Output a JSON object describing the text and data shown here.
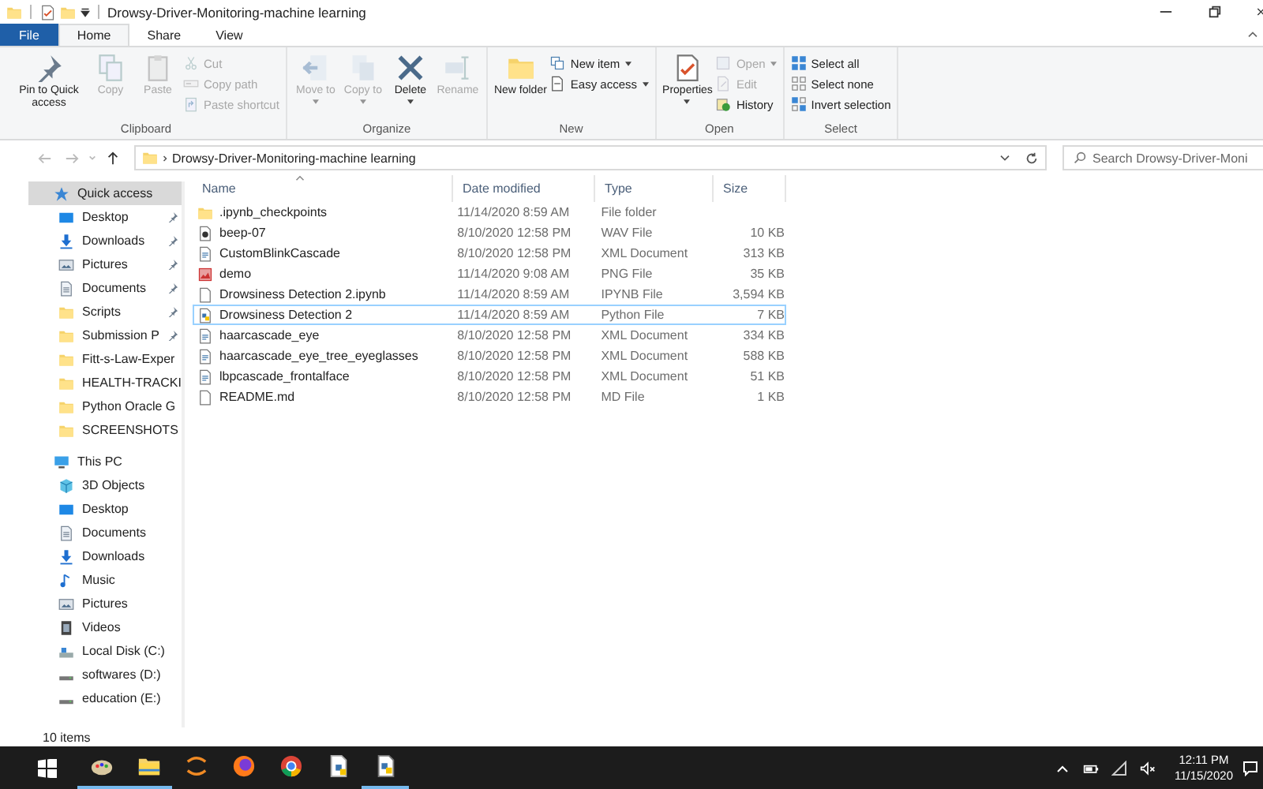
{
  "window": {
    "title": "Drowsy-Driver-Monitoring-machine learning"
  },
  "ribbon_tabs": [
    {
      "label": "File",
      "kind": "file",
      "selected": false
    },
    {
      "label": "Home",
      "kind": "tab",
      "selected": true
    },
    {
      "label": "Share",
      "kind": "tab",
      "selected": false
    },
    {
      "label": "View",
      "kind": "tab",
      "selected": false
    }
  ],
  "ribbon_groups": [
    {
      "label": "Clipboard",
      "large_commands": [
        {
          "label": "Pin to Quick access",
          "kind": "pin",
          "disabled": false,
          "dropdown": false
        },
        {
          "label": "Copy",
          "kind": "copy",
          "disabled": true,
          "dropdown": false
        },
        {
          "label": "Paste",
          "kind": "paste",
          "disabled": true,
          "dropdown": false
        }
      ],
      "small_commands": [
        {
          "label": "Cut",
          "kind": "cut",
          "disabled": true,
          "dropdown": false
        },
        {
          "label": "Copy path",
          "kind": "copypath",
          "disabled": true,
          "dropdown": false
        },
        {
          "label": "Paste shortcut",
          "kind": "pasteshortcut",
          "disabled": true,
          "dropdown": false
        }
      ]
    },
    {
      "label": "Organize",
      "large_commands": [
        {
          "label": "Move to",
          "kind": "moveto",
          "disabled": true,
          "dropdown": true
        },
        {
          "label": "Copy to",
          "kind": "copyto",
          "disabled": true,
          "dropdown": true
        },
        {
          "label": "Delete",
          "kind": "delete",
          "disabled": false,
          "dropdown": true
        },
        {
          "label": "Rename",
          "kind": "rename",
          "disabled": true,
          "dropdown": false
        }
      ]
    },
    {
      "label": "New",
      "large_commands": [
        {
          "label": "New folder",
          "kind": "folder",
          "disabled": false,
          "dropdown": false
        }
      ],
      "small_commands": [
        {
          "label": "New item",
          "kind": "newitem",
          "disabled": false,
          "dropdown": true
        },
        {
          "label": "Easy access",
          "kind": "easyaccess",
          "disabled": false,
          "dropdown": true
        }
      ]
    },
    {
      "label": "Open",
      "large_commands": [
        {
          "label": "Properties",
          "kind": "properties",
          "disabled": false,
          "dropdown": true
        }
      ],
      "small_commands": [
        {
          "label": "Open",
          "kind": "open",
          "disabled": true,
          "dropdown": true
        },
        {
          "label": "Edit",
          "kind": "edit",
          "disabled": true,
          "dropdown": false
        },
        {
          "label": "History",
          "kind": "history",
          "disabled": false,
          "dropdown": false
        }
      ]
    },
    {
      "label": "Select",
      "small_commands": [
        {
          "label": "Select all",
          "kind": "selectall",
          "disabled": false,
          "dropdown": false
        },
        {
          "label": "Select none",
          "kind": "selectnone",
          "disabled": false,
          "dropdown": false
        },
        {
          "label": "Invert selection",
          "kind": "invert",
          "disabled": false,
          "dropdown": false
        }
      ]
    }
  ],
  "address_bar": {
    "path": "Drowsy-Driver-Monitoring-machine learning",
    "search_placeholder": "Search Drowsy-Driver-Moni"
  },
  "navigation": [
    {
      "label": "Quick access",
      "kind": "star",
      "selected": true,
      "pinned": false,
      "children": [
        {
          "label": "Desktop",
          "kind": "desktop",
          "selected": false,
          "pinned": true
        },
        {
          "label": "Downloads",
          "kind": "download",
          "selected": false,
          "pinned": true
        },
        {
          "label": "Pictures",
          "kind": "pictures",
          "selected": false,
          "pinned": true
        },
        {
          "label": "Documents",
          "kind": "documents",
          "selected": false,
          "pinned": true
        },
        {
          "label": "Scripts",
          "kind": "folder",
          "selected": false,
          "pinned": true
        },
        {
          "label": "Submission P",
          "kind": "folder",
          "selected": false,
          "pinned": true
        },
        {
          "label": "Fitt-s-Law-Exper",
          "kind": "folder",
          "selected": false,
          "pinned": false
        },
        {
          "label": "HEALTH-TRACKI",
          "kind": "folder",
          "selected": false,
          "pinned": false
        },
        {
          "label": "Python Oracle G",
          "kind": "folder",
          "selected": false,
          "pinned": false
        },
        {
          "label": "SCREENSHOTS",
          "kind": "folder",
          "selected": false,
          "pinned": false
        }
      ]
    },
    {
      "label": "This PC",
      "kind": "pc",
      "selected": false,
      "pinned": false,
      "children": [
        {
          "label": "3D Objects",
          "kind": "cube",
          "selected": false,
          "pinned": false
        },
        {
          "label": "Desktop",
          "kind": "desktop",
          "selected": false,
          "pinned": false
        },
        {
          "label": "Documents",
          "kind": "documents",
          "selected": false,
          "pinned": false
        },
        {
          "label": "Downloads",
          "kind": "download",
          "selected": false,
          "pinned": false
        },
        {
          "label": "Music",
          "kind": "music",
          "selected": false,
          "pinned": false
        },
        {
          "label": "Pictures",
          "kind": "pictures",
          "selected": false,
          "pinned": false
        },
        {
          "label": "Videos",
          "kind": "videos",
          "selected": false,
          "pinned": false
        },
        {
          "label": "Local Disk (C:)",
          "kind": "disk",
          "selected": false,
          "pinned": false
        },
        {
          "label": "softwares (D:)",
          "kind": "drive",
          "selected": false,
          "pinned": false
        },
        {
          "label": "education (E:)",
          "kind": "drive",
          "selected": false,
          "pinned": false
        }
      ]
    }
  ],
  "table": {
    "columns": [
      "Name",
      "Date modified",
      "Type",
      "Size"
    ],
    "rows": [
      {
        "name": ".ipynb_checkpoints",
        "kind": "folder",
        "date": "11/14/2020 8:59 AM",
        "type": "File folder",
        "size": "",
        "selected": false
      },
      {
        "name": "beep-07",
        "kind": "audio",
        "date": "8/10/2020 12:58 PM",
        "type": "WAV File",
        "size": "10 KB",
        "selected": false
      },
      {
        "name": "CustomBlinkCascade",
        "kind": "xml",
        "date": "8/10/2020 12:58 PM",
        "type": "XML Document",
        "size": "313 KB",
        "selected": false
      },
      {
        "name": "demo",
        "kind": "image",
        "date": "11/14/2020 9:08 AM",
        "type": "PNG File",
        "size": "35 KB",
        "selected": false
      },
      {
        "name": "Drowsiness Detection 2.ipynb",
        "kind": "file",
        "date": "11/14/2020 8:59 AM",
        "type": "IPYNB File",
        "size": "3,594 KB",
        "selected": false
      },
      {
        "name": "Drowsiness Detection 2",
        "kind": "python",
        "date": "11/14/2020 8:59 AM",
        "type": "Python File",
        "size": "7 KB",
        "selected": true
      },
      {
        "name": "haarcascade_eye",
        "kind": "xml",
        "date": "8/10/2020 12:58 PM",
        "type": "XML Document",
        "size": "334 KB",
        "selected": false
      },
      {
        "name": "haarcascade_eye_tree_eyeglasses",
        "kind": "xml",
        "date": "8/10/2020 12:58 PM",
        "type": "XML Document",
        "size": "588 KB",
        "selected": false
      },
      {
        "name": "lbpcascade_frontalface",
        "kind": "xml",
        "date": "8/10/2020 12:58 PM",
        "type": "XML Document",
        "size": "51 KB",
        "selected": false
      },
      {
        "name": "README.md",
        "kind": "file",
        "date": "8/10/2020 12:58 PM",
        "type": "MD File",
        "size": "1 KB",
        "selected": false
      }
    ]
  },
  "status_bar": {
    "item_count": "10 items"
  },
  "taskbar": {
    "apps": [
      {
        "kind": "paint",
        "running": true
      },
      {
        "kind": "explorer",
        "running": true
      },
      {
        "kind": "orbit",
        "running": false
      },
      {
        "kind": "firefox",
        "running": false
      },
      {
        "kind": "chrome",
        "running": false
      },
      {
        "kind": "pyfile",
        "running": false
      },
      {
        "kind": "python",
        "running": true
      }
    ],
    "time": "12:11 PM",
    "date": "11/15/2020"
  }
}
